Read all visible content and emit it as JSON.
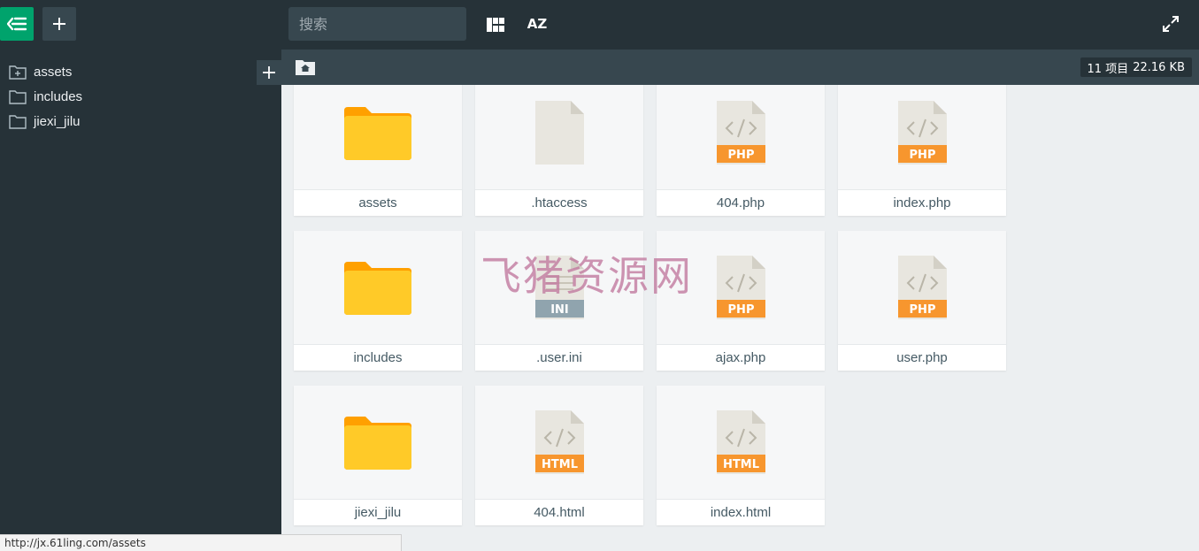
{
  "topbar": {
    "search_placeholder": "搜索",
    "sort_label": "AZ"
  },
  "sidebar": {
    "items": [
      {
        "label": "assets"
      },
      {
        "label": "includes"
      },
      {
        "label": "jiexi_jilu"
      }
    ]
  },
  "pathbar": {
    "item_count": "11 项目",
    "total_size": "22.16 KB"
  },
  "files": [
    {
      "name": "assets",
      "kind": "folder"
    },
    {
      "name": ".htaccess",
      "kind": "blank"
    },
    {
      "name": "404.php",
      "kind": "code",
      "badge": "PHP"
    },
    {
      "name": "index.php",
      "kind": "code",
      "badge": "PHP"
    },
    {
      "name": "includes",
      "kind": "folder"
    },
    {
      "name": ".user.ini",
      "kind": "ini",
      "badge": "INI"
    },
    {
      "name": "ajax.php",
      "kind": "code",
      "badge": "PHP"
    },
    {
      "name": "user.php",
      "kind": "code",
      "badge": "PHP"
    },
    {
      "name": "jiexi_jilu",
      "kind": "folder"
    },
    {
      "name": "404.html",
      "kind": "code",
      "badge": "HTML"
    },
    {
      "name": "index.html",
      "kind": "code",
      "badge": "HTML"
    }
  ],
  "watermark": "飞猪资源网",
  "status_url": "http://jx.61ling.com/assets",
  "colors": {
    "accent": "#00a36c",
    "dark": "#263238",
    "folder": "#ffca28",
    "badge_orange": "#f7962e",
    "badge_grey": "#90a4ae"
  }
}
